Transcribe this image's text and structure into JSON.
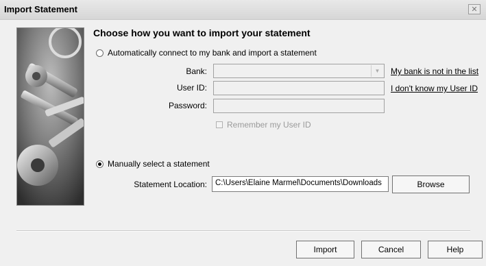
{
  "window": {
    "title": "Import Statement"
  },
  "heading": "Choose how you want to import your statement",
  "auto_option": {
    "label": "Automatically connect to my bank and import a statement",
    "bank_label": "Bank:",
    "bank_value": "",
    "userid_label": "User ID:",
    "userid_value": "",
    "password_label": "Password:",
    "password_value": "",
    "bank_link": "My bank is not in the list",
    "userid_link": "I don't know my User ID",
    "remember_label": "Remember my User ID"
  },
  "manual_option": {
    "label": "Manually select a statement",
    "location_label": "Statement Location:",
    "location_value": "C:\\Users\\Elaine Marmel\\Documents\\Downloads",
    "browse_label": "Browse"
  },
  "buttons": {
    "import": "Import",
    "cancel": "Cancel",
    "help": "Help"
  }
}
